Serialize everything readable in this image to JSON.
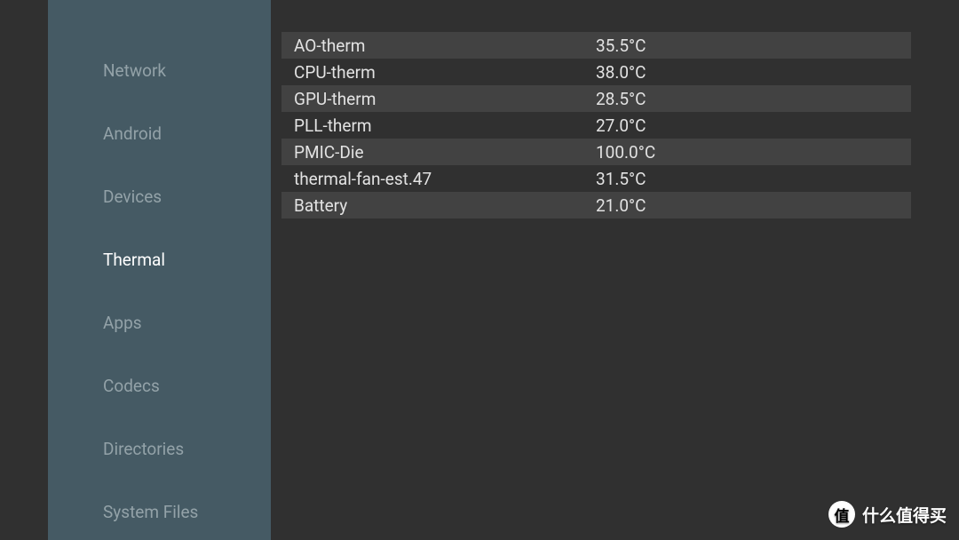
{
  "sidebar": {
    "items": [
      {
        "label": "Network"
      },
      {
        "label": "Android"
      },
      {
        "label": "Devices"
      },
      {
        "label": "Thermal"
      },
      {
        "label": "Apps"
      },
      {
        "label": "Codecs"
      },
      {
        "label": "Directories"
      },
      {
        "label": "System Files"
      }
    ],
    "active_index": 3
  },
  "thermal": {
    "rows": [
      {
        "name": "AO-therm",
        "value": "35.5°C"
      },
      {
        "name": "CPU-therm",
        "value": "38.0°C"
      },
      {
        "name": "GPU-therm",
        "value": "28.5°C"
      },
      {
        "name": "PLL-therm",
        "value": "27.0°C"
      },
      {
        "name": "PMIC-Die",
        "value": "100.0°C"
      },
      {
        "name": "thermal-fan-est.47",
        "value": "31.5°C"
      },
      {
        "name": "Battery",
        "value": "21.0°C"
      }
    ]
  },
  "watermark": {
    "badge": "值",
    "text": "什么值得买"
  }
}
